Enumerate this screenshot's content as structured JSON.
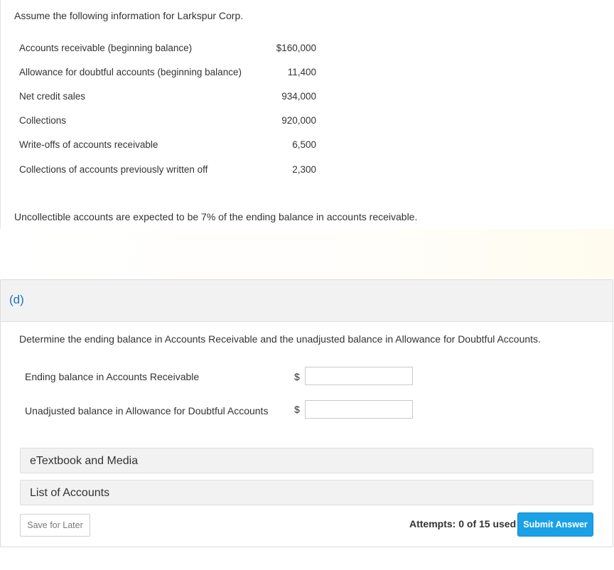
{
  "intro": {
    "heading": "Assume the following information for Larkspur Corp.",
    "rows": [
      {
        "label": "Accounts receivable (beginning balance)",
        "value": "$160,000"
      },
      {
        "label": "Allowance for doubtful accounts (beginning balance)",
        "value": "11,400"
      },
      {
        "label": "Net credit sales",
        "value": "934,000"
      },
      {
        "label": "Collections",
        "value": "920,000"
      },
      {
        "label": "Write-offs of accounts receivable",
        "value": "6,500"
      },
      {
        "label": "Collections of accounts previously written off",
        "value": "2,300"
      }
    ],
    "note": "Uncollectible accounts are expected to be 7% of the ending balance in accounts receivable."
  },
  "part": {
    "label": "(d)",
    "question": "Determine the ending balance in Accounts Receivable and the unadjusted balance in Allowance for Doubtful Accounts.",
    "fields": [
      {
        "label": "Ending balance in Accounts Receivable",
        "currency": "$",
        "value": ""
      },
      {
        "label": "Unadjusted balance in Allowance for Doubtful Accounts",
        "currency": "$",
        "value": ""
      }
    ],
    "resources": [
      {
        "label": "eTextbook and Media"
      },
      {
        "label": "List of Accounts"
      }
    ],
    "footer": {
      "save_label": "Save for Later",
      "attempts_text": "Attempts: 0 of 15 used",
      "submit_label": "Submit Answer"
    }
  }
}
